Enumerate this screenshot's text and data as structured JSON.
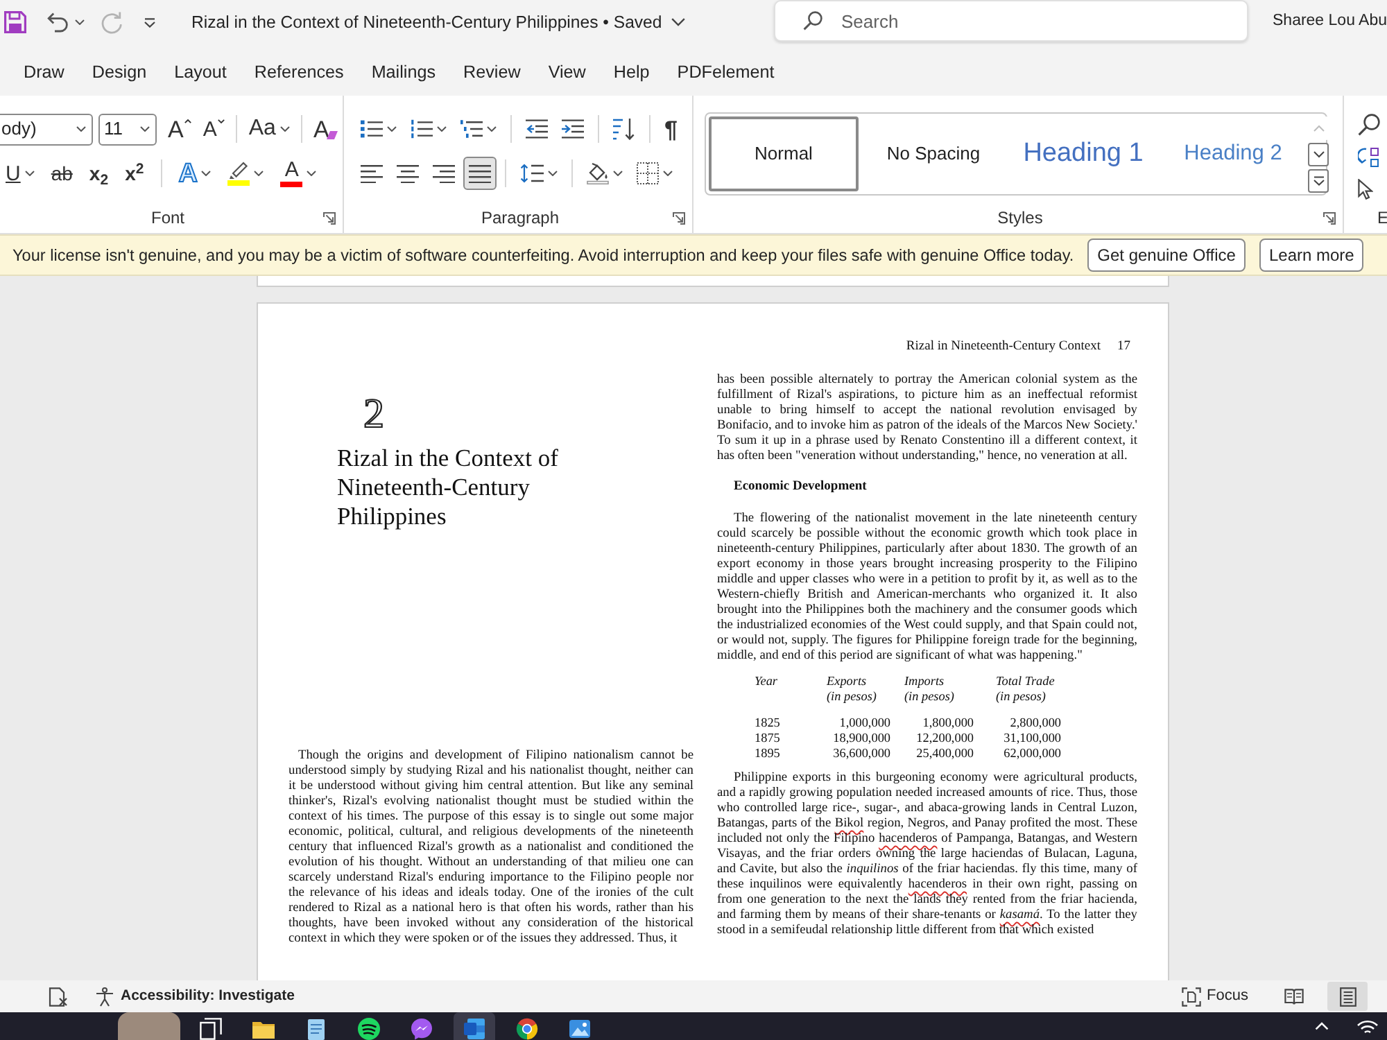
{
  "title_bar": {
    "quick_access": [
      {
        "kind": "save",
        "dropdown": false,
        "disabled": false
      },
      {
        "kind": "undo",
        "dropdown": true,
        "disabled": false
      },
      {
        "kind": "redo",
        "dropdown": false,
        "disabled": true
      },
      {
        "kind": "customize",
        "dropdown": false,
        "disabled": false
      }
    ],
    "title": "Rizal in the Context of Nineteenth-Century Philippines • Saved",
    "search": {
      "placeholder": "Search"
    },
    "user_name": "Sharee Lou Abu"
  },
  "ribbon_tabs": [
    {
      "label": "Draw",
      "selected": false
    },
    {
      "label": "Design",
      "selected": false
    },
    {
      "label": "Layout",
      "selected": false
    },
    {
      "label": "References",
      "selected": false
    },
    {
      "label": "Mailings",
      "selected": false
    },
    {
      "label": "Review",
      "selected": false
    },
    {
      "label": "View",
      "selected": false
    },
    {
      "label": "Help",
      "selected": false
    },
    {
      "label": "PDFelement",
      "selected": false
    }
  ],
  "ribbon": {
    "font": {
      "label": "Font",
      "font_name": "ody)",
      "font_size": "11",
      "top_line": [
        {
          "buttons": [
            {
              "kind": "grow",
              "glyph": "A",
              "dropdown": false,
              "selected": false
            },
            {
              "kind": "shrink",
              "glyph": "A",
              "dropdown": false,
              "selected": false
            }
          ]
        },
        {
          "buttons": [
            {
              "kind": "case",
              "glyph": "Aa",
              "dropdown": true,
              "selected": false
            }
          ]
        },
        {
          "buttons": [
            {
              "kind": "clear",
              "glyph": "A",
              "dropdown": false,
              "selected": false
            }
          ]
        }
      ],
      "bottom_line": [
        {
          "buttons": [
            {
              "kind": "underline",
              "glyph": "U",
              "dropdown": true,
              "selected": false
            },
            {
              "kind": "strike",
              "glyph": "ab",
              "dropdown": false,
              "selected": false
            },
            {
              "kind": "subscript",
              "glyph": "x$_{2}$",
              "dropdown": false,
              "selected": false
            },
            {
              "kind": "superscript",
              "glyph": "x$^{2}$",
              "dropdown": false,
              "selected": false
            }
          ]
        },
        {
          "buttons": [
            {
              "kind": "effects",
              "glyph": "A",
              "dropdown": true,
              "selected": false
            },
            {
              "kind": "highlight",
              "color": "#ffff00",
              "dropdown": true,
              "selected": false
            },
            {
              "kind": "font_color",
              "glyph": "A",
              "color": "#ff0000",
              "dropdown": true,
              "selected": false
            }
          ]
        }
      ]
    },
    "paragraph": {
      "label": "Paragraph",
      "top_line": [
        {
          "buttons": [
            {
              "kind": "bullets",
              "dropdown": true,
              "selected": false
            },
            {
              "kind": "numbering",
              "dropdown": true,
              "selected": false
            },
            {
              "kind": "multilevel",
              "dropdown": true,
              "selected": false
            }
          ]
        },
        {
          "buttons": [
            {
              "kind": "outdent",
              "dropdown": false,
              "selected": false
            },
            {
              "kind": "indent",
              "dropdown": false,
              "selected": false
            }
          ]
        },
        {
          "buttons": [
            {
              "kind": "sort",
              "dropdown": false,
              "selected": false
            }
          ]
        },
        {
          "buttons": [
            {
              "kind": "marks",
              "glyph": "¶",
              "dropdown": false,
              "selected": false
            }
          ]
        }
      ],
      "bottom_line": [
        {
          "buttons": [
            {
              "kind": "align_left",
              "dropdown": false,
              "selected": false
            },
            {
              "kind": "align_center",
              "dropdown": false,
              "selected": false
            },
            {
              "kind": "align_right",
              "dropdown": false,
              "selected": false
            },
            {
              "kind": "justify",
              "dropdown": false,
              "selected": true
            }
          ]
        },
        {
          "buttons": [
            {
              "kind": "line_spacing",
              "dropdown": true,
              "selected": false
            }
          ]
        },
        {
          "buttons": [
            {
              "kind": "shading",
              "dropdown": true,
              "selected": false
            },
            {
              "kind": "borders",
              "dropdown": true,
              "selected": false
            }
          ]
        }
      ]
    },
    "styles": {
      "label": "Styles",
      "items": [
        {
          "label": "Normal",
          "kind": "body",
          "selected": true
        },
        {
          "label": "No Spacing",
          "kind": "body",
          "selected": false
        },
        {
          "label": "Heading 1",
          "kind": "heading1",
          "selected": false
        },
        {
          "label": "Heading 2",
          "kind": "heading2",
          "selected": false
        }
      ],
      "scroll_up_disabled": true
    },
    "editing": {
      "label": "E"
    }
  },
  "license_bar": {
    "message": "Your license isn't genuine, and you may be a victim of software counterfeiting. Avoid interruption and keep your files safe with genuine Office today.",
    "buttons": [
      {
        "label": "Get genuine Office"
      },
      {
        "label": "Learn more"
      }
    ]
  },
  "page": {
    "running_head": "Rizal in Nineteenth-Century Context",
    "page_number": "17",
    "chapter_number": "2",
    "chapter_title": "Rizal in the Context of Nineteenth-Century Philippines",
    "left_column": [
      {
        "kind": "paragraph",
        "runs": [
          {
            "kind": "plain",
            "text": "Though the origins and development of Filipino nationalism cannot be understood simply by studying Rizal and his nationalist thought, neither can it be understood without giving him central attention. But like any seminal thinker's, Rizal's evolving nationalist thought must be studied within the context of his times. The purpose of this essay is to single out some major economic, political, cultural, and religious developments of the nineteenth century that influenced Rizal's growth as a nationalist and conditioned the evolution of his thought. Without an understanding of that milieu one can scarcely understand Rizal's enduring importance to the Filipino people nor the relevance of his ideas and ideals today. One of the ironies of the cult rendered to Rizal as a national hero is that often his words, rather than his thoughts, have been invoked without any consideration of the historical context in which they were spoken or of the issues they addressed. Thus, it"
          }
        ]
      }
    ],
    "right_column": [
      {
        "kind": "continued_paragraph",
        "runs": [
          {
            "kind": "plain",
            "text": "has been possible alternately to portray the American colonial system as the fulfillment of Rizal's aspirations, to picture him as an ineffectual reformist unable to bring himself to accept the national revolution envisaged by Bonifacio, and to invoke him as patron of the ideals of the Marcos New Society.' To sum it up in a phrase used by Renato Constentino ill a different context, it has often been \"veneration without understanding,\" hence, no veneration at all."
          }
        ]
      },
      {
        "kind": "heading",
        "text": "Economic Development"
      },
      {
        "kind": "paragraph",
        "runs": [
          {
            "kind": "plain",
            "text": "The flowering of the nationalist movement in the late nineteenth century could scarcely be possible without the economic growth which took place in nineteenth-century Philippines, particularly after about 1830. The growth of an export economy in those years brought increasing prosperity to the Filipino middle and upper classes who were in a petition to profit by it, as well as to the Western-chiefly British and American-merchants who organized it. It also brought into the Philippines both the machinery and the consumer goods which the industrialized economies of the West could supply, and that Spain could not, or would not, supply. The figures for Philippine foreign trade for the beginning, middle, and end of this period are significant of what was happening.\""
          }
        ]
      },
      {
        "kind": "table",
        "columns": [
          {
            "label": "Year"
          },
          {
            "label": "Exports",
            "unit": "(in pesos)"
          },
          {
            "label": "Imports",
            "unit": "(in pesos)"
          },
          {
            "label": "Total Trade",
            "unit": "(in pesos)"
          }
        ],
        "rows": [
          [
            "1825",
            "1,000,000",
            "1,800,000",
            "2,800,000"
          ],
          [
            "1875",
            "18,900,000",
            "12,200,000",
            "31,100,000"
          ],
          [
            "1895",
            "36,600,000",
            "25,400,000",
            "62,000,000"
          ]
        ]
      },
      {
        "kind": "paragraph",
        "runs": [
          {
            "kind": "plain",
            "text": "Philippine exports in this burgeoning economy were agricultural products, and a rapidly growing population needed increased amounts of rice. Thus, those who controlled large rice-, sugar-, and abaca-growing lands in Central Luzon, Batangas, parts of the "
          },
          {
            "kind": "spelling_flag",
            "text": "Bikol"
          },
          {
            "kind": "plain",
            "text": " region, Negros, and Panay profited the most. These included not only the Filipino "
          },
          {
            "kind": "spelling_flag",
            "text": "hacenderos"
          },
          {
            "kind": "plain",
            "text": " of Pampanga, Batangas, and Western Visayas, and the friar orders owning the large haciendas of Bulacan, Laguna, and Cavite, but also the *inquilinos* of the friar haciendas. fly this time, many of these inquilinos were equivalently "
          },
          {
            "kind": "spelling_flag",
            "text": "hacenderos"
          },
          {
            "kind": "plain",
            "text": " in their own right, passing on from one generation to the next the lands they rented from the friar hacienda, and farming them by means of their share-tenants or "
          },
          {
            "kind": "spelling_flag",
            "text": "*kasamá*"
          },
          {
            "kind": "plain",
            "text": ". To the latter they stood in a semifeudal relationship little different from that which existed"
          }
        ]
      }
    ]
  },
  "status_bar": {
    "accessibility": "Accessibility: Investigate",
    "focus": "Focus",
    "views": [
      {
        "kind": "read",
        "selected": false
      },
      {
        "kind": "print",
        "selected": true
      }
    ]
  },
  "taskbar": {
    "apps": [
      {
        "kind": "task_view",
        "selected": false
      },
      {
        "kind": "files",
        "selected": false
      },
      {
        "kind": "notes",
        "selected": false
      },
      {
        "kind": "music",
        "selected": false
      },
      {
        "kind": "chat",
        "selected": false
      },
      {
        "kind": "word",
        "selected": true
      },
      {
        "kind": "browser",
        "selected": false
      },
      {
        "kind": "photos",
        "selected": false
      }
    ]
  }
}
